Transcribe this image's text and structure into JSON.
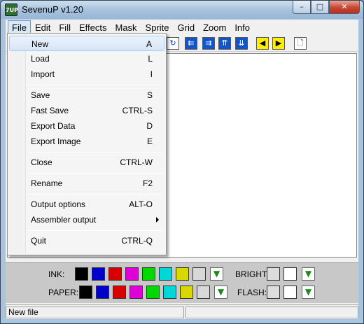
{
  "window": {
    "title": "SevenuP v1.20",
    "icon_text": "7UP"
  },
  "menubar": [
    "File",
    "Edit",
    "Fill",
    "Effects",
    "Mask",
    "Sprite",
    "Grid",
    "Zoom",
    "Info"
  ],
  "file_menu": {
    "items": [
      {
        "label": "New",
        "shortcut": "A"
      },
      {
        "label": "Load",
        "shortcut": "L"
      },
      {
        "label": "Import",
        "shortcut": "I"
      },
      {
        "label": "Save",
        "shortcut": "S"
      },
      {
        "label": "Fast Save",
        "shortcut": "CTRL-S"
      },
      {
        "label": "Export Data",
        "shortcut": "D"
      },
      {
        "label": "Export Image",
        "shortcut": "E"
      },
      {
        "label": "Close",
        "shortcut": "CTRL-W"
      },
      {
        "label": "Rename",
        "shortcut": "F2"
      },
      {
        "label": "Output options",
        "shortcut": "ALT-O"
      },
      {
        "label": "Assembler output",
        "shortcut": ""
      },
      {
        "label": "Quit",
        "shortcut": "CTRL-Q"
      }
    ]
  },
  "palette": {
    "ink_label": "INK:",
    "paper_label": "PAPER:",
    "bright_label": "BRIGHT:",
    "flash_label": "FLASH:",
    "colors": [
      "#000000",
      "#0000c8",
      "#d80000",
      "#e000d8",
      "#00d800",
      "#00d8d8",
      "#d8d800",
      "#d8d8d8"
    ]
  },
  "statusbar": {
    "text": "New file"
  }
}
